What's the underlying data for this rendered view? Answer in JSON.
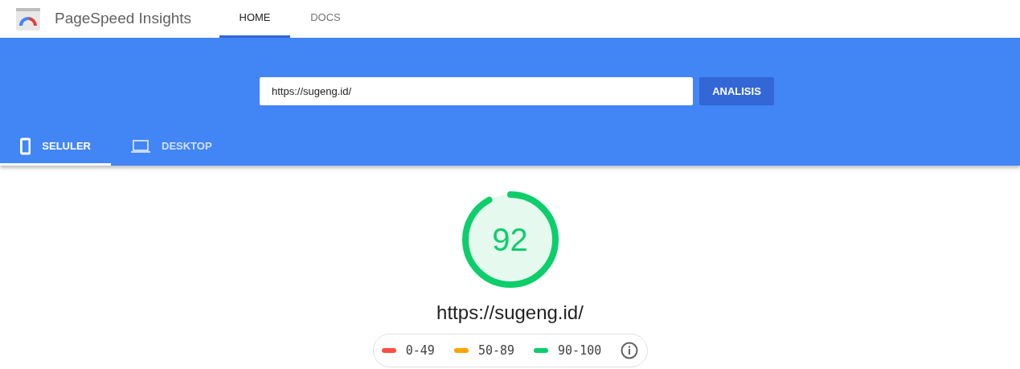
{
  "header": {
    "title": "PageSpeed Insights",
    "nav": [
      {
        "label": "HOME",
        "selected": true
      },
      {
        "label": "DOCS",
        "selected": false
      }
    ]
  },
  "search": {
    "value": "https://sugeng.id/",
    "button": "ANALISIS"
  },
  "device_tabs": [
    {
      "label": "SELULER",
      "kind": "phone",
      "selected": true
    },
    {
      "label": "DESKTOP",
      "kind": "laptop",
      "selected": false
    }
  ],
  "score": {
    "value": "92"
  },
  "url": "https://sugeng.id/",
  "legend": [
    {
      "label": "0-49",
      "color": "#ff4e42"
    },
    {
      "label": "50-89",
      "color": "#ffa400"
    },
    {
      "label": "90-100",
      "color": "#0cce6b"
    }
  ]
}
